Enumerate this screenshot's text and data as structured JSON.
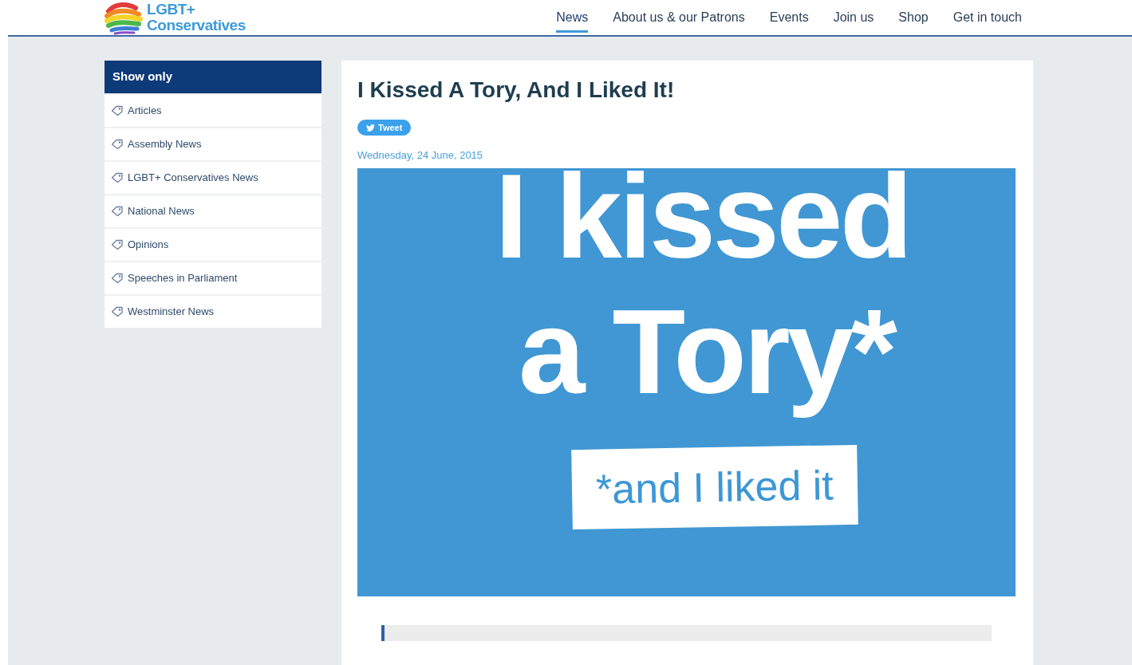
{
  "logo": {
    "line_1": "LGBT+",
    "line_2": "Conservatives"
  },
  "nav": [
    {
      "label": "News",
      "selected": true
    },
    {
      "label": "About us & our Patrons",
      "selected": false
    },
    {
      "label": "Events",
      "selected": false
    },
    {
      "label": "Join us",
      "selected": false
    },
    {
      "label": "Shop",
      "selected": false
    },
    {
      "label": "Get in touch",
      "selected": false
    }
  ],
  "sidebar": {
    "title": "Show only",
    "items": [
      "Articles",
      "Assembly News",
      "LGBT+ Conservatives News",
      "National News",
      "Opinions",
      "Speeches in Parliament",
      "Westminster News"
    ]
  },
  "article": {
    "title": "I Kissed A Tory, And I Liked It!",
    "tweet_button": "Tweet",
    "date": "Wednesday, 24 June, 2015",
    "image": {
      "line_1": "I kissed",
      "line_2": "a Tory*",
      "label": "*and I liked it"
    }
  }
}
